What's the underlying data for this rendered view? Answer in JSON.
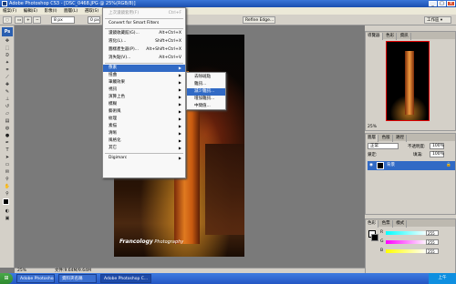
{
  "window": {
    "title": "Adobe Photoshop CS3 - [DSC_0468.JPG @ 25%(RGB/8)]"
  },
  "menubar": {
    "items": [
      "檔案(F)",
      "編輯(E)",
      "影像(I)",
      "圖層(L)",
      "選取(S)",
      "濾鏡(T)",
      "檢視(V)",
      "視窗(W)",
      "說明(H)"
    ],
    "active_index": 5
  },
  "options": {
    "brush_size": "8 px",
    "feather": "0 px",
    "refine": "Refine Edge...",
    "workspace": "工作區 ▾"
  },
  "filter_menu": {
    "items": [
      {
        "label": "上次濾鏡套用(F)",
        "shortcut": "Ctrl+F",
        "disabled": true
      },
      {
        "label": "Convert for Smart Filters",
        "shortcut": ""
      },
      {
        "label": "濾鏡收藏館(G)...",
        "shortcut": "Alt+Ctrl+X"
      },
      {
        "label": "液化(L)...",
        "shortcut": "Shift+Ctrl+X"
      },
      {
        "label": "圖樣產生器(P)...",
        "shortcut": "Alt+Shift+Ctrl+X"
      },
      {
        "label": "消失點(V)...",
        "shortcut": "Alt+Ctrl+V"
      },
      {
        "label": "像素",
        "submenu": true,
        "highlighted": true
      },
      {
        "label": "扭曲",
        "submenu": true
      },
      {
        "label": "筆觸效果",
        "submenu": true
      },
      {
        "label": "視訊",
        "submenu": true
      },
      {
        "label": "演算上色",
        "submenu": true
      },
      {
        "label": "模糊",
        "submenu": true
      },
      {
        "label": "藝術風",
        "submenu": true
      },
      {
        "label": "紋理",
        "submenu": true
      },
      {
        "label": "素描",
        "submenu": true
      },
      {
        "label": "清晰",
        "submenu": true
      },
      {
        "label": "風格化",
        "submenu": true
      },
      {
        "label": "其它",
        "submenu": true
      },
      {
        "label": "Digimarc",
        "submenu": true
      }
    ]
  },
  "submenu": {
    "items": [
      "去除斑點",
      "雜訊...",
      "減少雜訊...",
      "增加雜訊...",
      "中間值..."
    ],
    "highlighted_index": 2
  },
  "navigator": {
    "tabs": [
      "導覽器",
      "色彩",
      "資訊"
    ],
    "zoom": "25%"
  },
  "layers": {
    "tabs": [
      "圖層",
      "色版",
      "路徑"
    ],
    "blend_mode": "正常",
    "opacity_label": "不透明度:",
    "opacity": "100%",
    "lock_label": "鎖定:",
    "fill_label": "填滿:",
    "fill": "100%",
    "layer_name": "背景"
  },
  "color": {
    "tabs": [
      "色彩",
      "色票",
      "樣式"
    ],
    "r_value": "255",
    "g_value": "255",
    "b_value": "255"
  },
  "watermark": {
    "brand": "Francology",
    "tag": "Photography"
  },
  "status": {
    "zoom": "25%",
    "doc": "文件:9.64M/9.64M"
  },
  "taskbar": {
    "tasks": [
      "Adobe Photoshop ...",
      "資料夾名稱",
      "Adobe Photoshop C..."
    ],
    "active_index": 2,
    "clock": "上午"
  }
}
